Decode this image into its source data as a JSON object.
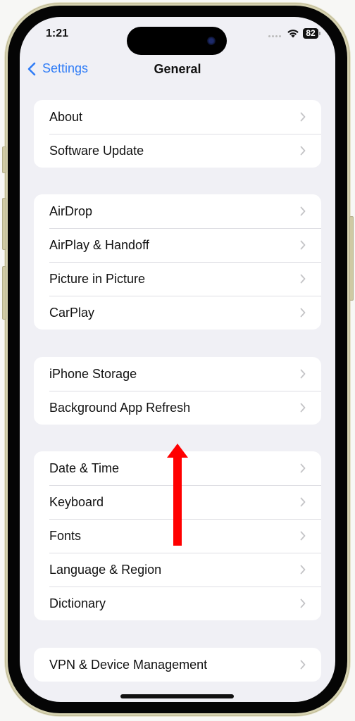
{
  "status_bar": {
    "time": "1:21",
    "battery": "82",
    "icons": [
      "cellular-signal-icon",
      "wifi-icon",
      "battery-icon"
    ]
  },
  "nav": {
    "back_label": "Settings",
    "title": "General",
    "back_icon": "chevron-left-icon"
  },
  "groups": [
    {
      "items": [
        {
          "label": "About"
        },
        {
          "label": "Software Update"
        }
      ]
    },
    {
      "items": [
        {
          "label": "AirDrop"
        },
        {
          "label": "AirPlay & Handoff"
        },
        {
          "label": "Picture in Picture"
        },
        {
          "label": "CarPlay"
        }
      ]
    },
    {
      "items": [
        {
          "label": "iPhone Storage"
        },
        {
          "label": "Background App Refresh"
        }
      ]
    },
    {
      "items": [
        {
          "label": "Date & Time"
        },
        {
          "label": "Keyboard"
        },
        {
          "label": "Fonts"
        },
        {
          "label": "Language & Region"
        },
        {
          "label": "Dictionary"
        }
      ]
    },
    {
      "items": [
        {
          "label": "VPN & Device Management"
        }
      ]
    }
  ],
  "annotation": {
    "type": "arrow",
    "direction": "up",
    "meaning": "swipe-up",
    "color": "#ff0000"
  },
  "colors": {
    "accent": "#2f7cf6",
    "background": "#f0f0f5",
    "card": "#ffffff",
    "frame": "#d6d2b0"
  }
}
